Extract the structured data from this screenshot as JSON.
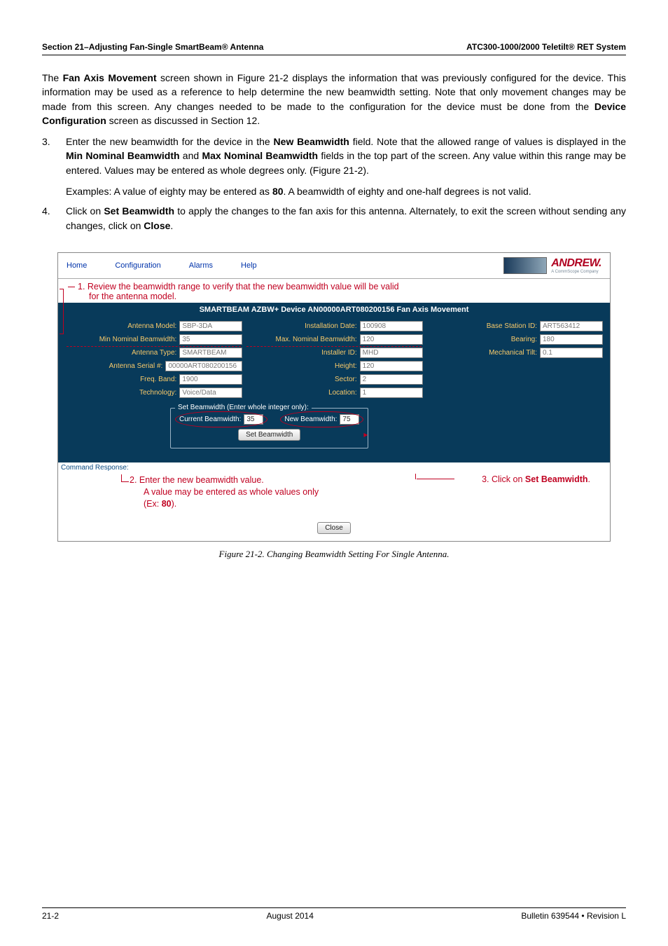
{
  "header": {
    "left": "Section 21–Adjusting Fan-Single SmartBeam® Antenna",
    "right": "ATC300-1000/2000 Teletilt® RET System"
  },
  "para1_prefix": "The ",
  "para1_bold": "Fan Axis Movement",
  "para1_rest": " screen shown in Figure 21-2 displays the information that was previously configured for the device. This information may be used as a reference to help determine the new beamwidth setting. Note that only movement changes may be made from this screen. Any changes needed to be made to the configuration for the device must be done from the ",
  "para1_bold2": "Device Configuration",
  "para1_tail": " screen as discussed in Section 12.",
  "item3_num": "3.",
  "item3_a": "Enter the new beamwidth for the device in the ",
  "item3_b1": "New Beamwidth",
  "item3_c": " field. Note that the allowed range of values is displayed in the ",
  "item3_b2": "Min Nominal Beamwidth",
  "item3_d": " and ",
  "item3_b3": "Max Nominal Beamwidth",
  "item3_e": " fields in the top part of the screen. Any value within this range may be entered. Values may be entered as whole degrees only. (Figure 21-2).",
  "item3_sub_a": "Examples: A value of eighty may be entered as ",
  "item3_sub_b": "80",
  "item3_sub_c": ". A beamwidth of eighty and one-half degrees is not valid.",
  "item4_num": "4.",
  "item4_a": "Click on ",
  "item4_b1": "Set Beamwidth",
  "item4_c": " to apply the changes to the fan axis for this antenna. Alternately, to exit the screen without sending any changes, click on ",
  "item4_b2": "Close",
  "item4_d": ".",
  "menu": {
    "home": "Home",
    "config": "Configuration",
    "alarms": "Alarms",
    "help": "Help"
  },
  "brand_name": "ANDREW.",
  "brand_sub": "A CommScope Company",
  "annot1_line1": "1.  Review the beamwidth range to verify that the new beamwidth value will be valid",
  "annot1_line2": "for the antenna model.",
  "panel_title": "SMARTBEAM AZBW+ Device AN00000ART080200156 Fan Axis Movement",
  "grid": {
    "r1": {
      "antenna_model_label": "Antenna Model:",
      "antenna_model": "SBP-3DA",
      "install_date_label": "Installation Date:",
      "install_date": "100908",
      "base_station_label": "Base Station ID:",
      "base_station": "ART563412"
    },
    "r2": {
      "min_bw_label": "Min Nominal Beamwidth:",
      "min_bw": "35",
      "max_bw_label": "Max. Nominal Beamwidth:",
      "max_bw": "120",
      "bearing_label": "Bearing:",
      "bearing": "180"
    },
    "r3": {
      "ant_type_label": "Antenna Type:",
      "ant_type": "SMARTBEAM",
      "installer_label": "Installer ID:",
      "installer": "MHD",
      "mech_tilt_label": "Mechanical Tilt:",
      "mech_tilt": "0.1"
    },
    "r4": {
      "serial_label": "Antenna Serial #:",
      "serial": "00000ART080200156",
      "height_label": "Height:",
      "height": "120"
    },
    "r5": {
      "freq_label": "Freq. Band:",
      "freq": "1900",
      "sector_label": "Sector:",
      "sector": "2"
    },
    "r6": {
      "tech_label": "Technology:",
      "tech": "Voice/Data",
      "loc_label": "Location:",
      "loc": "1"
    }
  },
  "fieldset": {
    "legend": "Set Beamwidth (Enter whole integer only):",
    "current_label": "Current Beamwidth:",
    "current": "35",
    "new_label": "New Beamwidth:",
    "new": "75",
    "button": "Set Beamwidth"
  },
  "output_label": "Command Response:",
  "annot2_line1": "2.  Enter the new beamwidth value.",
  "annot2_line2": "A value may be entered as whole values only",
  "annot2_line3_a": "(Ex: ",
  "annot2_line3_b": "80",
  "annot2_line3_c": ").",
  "annot3_a": "3. Click on ",
  "annot3_b": "Set Beamwidth",
  "annot3_c": ".",
  "close_btn": "Close",
  "caption": "Figure 21-2.  Changing Beamwidth Setting For Single Antenna.",
  "footer": {
    "left": "21-2",
    "center": "August 2014",
    "right": "Bulletin 639544  •  Revision L"
  }
}
